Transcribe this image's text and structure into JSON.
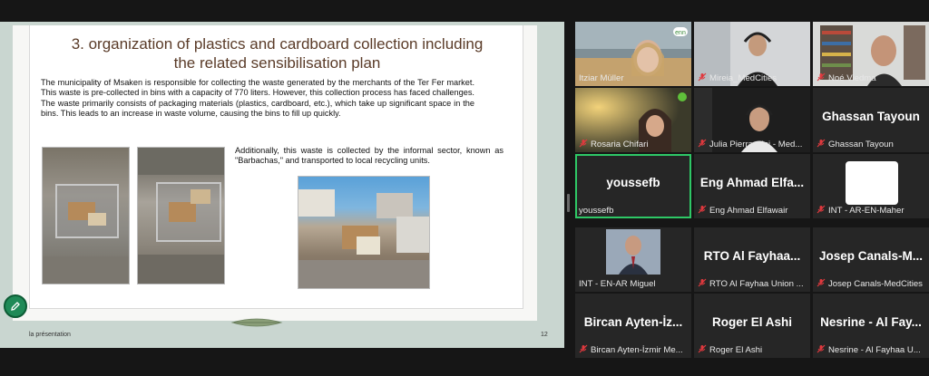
{
  "slide": {
    "title_line1": "3.  organization of plastics and cardboard collection including",
    "title_line2": "the related sensibilisation plan",
    "paragraph1": "The municipality of Msaken is responsible for collecting the waste generated by the merchants of the Ter Fer market. This waste is pre-collected in bins with a capacity of 770 liters. However, this collection process has faced challenges. The waste primarily consists of packaging materials (plastics, cardboard, etc.), which take up significant space in the bins. This leads to an increase in waste volume, causing the bins to fill up quickly.",
    "paragraph2": "Additionally, this waste is collected by the informal sector, known as \"Barbachas,\" and transported to local recycling units.",
    "footer_label": "la présentation",
    "page_number": "12"
  },
  "participants": [
    {
      "name": "Itziar Müller",
      "display": "",
      "muted": false,
      "has_video": true
    },
    {
      "name": "Mireia_MedCities",
      "display": "",
      "muted": true,
      "has_video": true
    },
    {
      "name": "Noé Viedma",
      "display": "",
      "muted": true,
      "has_video": true
    },
    {
      "name": "Rosaria Chifari",
      "display": "",
      "muted": true,
      "has_video": true
    },
    {
      "name": "Julia Pierraccini - Med...",
      "display": "",
      "muted": true,
      "has_video": true
    },
    {
      "name": "Ghassan Tayoun",
      "display": "Ghassan Tayoun",
      "muted": true,
      "has_video": false
    },
    {
      "name": "youssefb",
      "display": "youssefb",
      "muted": false,
      "has_video": false,
      "active": true
    },
    {
      "name": "Eng Ahmad Elfawair",
      "display": "Eng Ahmad  Elfa...",
      "muted": true,
      "has_video": false
    },
    {
      "name": "INT - AR-EN-Maher",
      "display": "",
      "muted": true,
      "has_video": false
    },
    {
      "name": "INT - EN-AR Miguel",
      "display": "",
      "muted": false,
      "has_video": true
    },
    {
      "name": "RTO Al Fayhaa Union ...",
      "display": "RTO  Al  Fayhaa...",
      "muted": true,
      "has_video": false
    },
    {
      "name": "Josep Canals-MedCities",
      "display": "Josep  Canals-M...",
      "muted": true,
      "has_video": false
    },
    {
      "name": "Bircan Ayten-İzmir Me...",
      "display": "Bircan  Ayten-İz...",
      "muted": true,
      "has_video": false
    },
    {
      "name": "Roger El Ashi",
      "display": "Roger El Ashi",
      "muted": true,
      "has_video": false
    },
    {
      "name": "Nesrine - Al Fayhaa U...",
      "display": "Nesrine  -  Al  Fay...",
      "muted": true,
      "has_video": false
    }
  ],
  "colors": {
    "active_border": "#2ec866",
    "mute_red": "#e0393e",
    "edit_green": "#1f8a57"
  },
  "icons": {
    "muted": "mic-muted-icon",
    "edit": "pencil-icon"
  }
}
